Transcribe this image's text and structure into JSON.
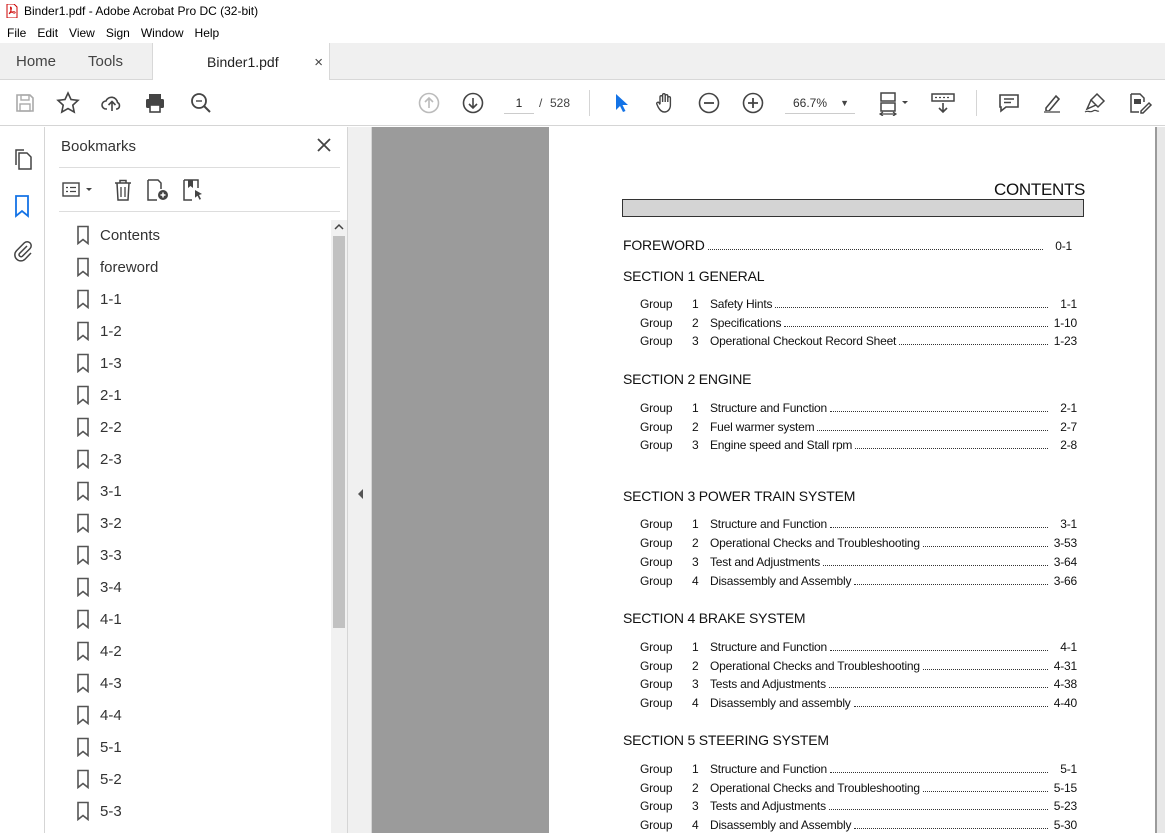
{
  "window": {
    "title": "Binder1.pdf - Adobe Acrobat Pro DC (32-bit)"
  },
  "menu": [
    "File",
    "Edit",
    "View",
    "Sign",
    "Window",
    "Help"
  ],
  "tabs": {
    "home": "Home",
    "tools": "Tools",
    "document": "Binder1.pdf",
    "close": "×"
  },
  "toolbar": {
    "page_current": "1",
    "page_sep": "/",
    "page_total": "528",
    "zoom": "66.7%"
  },
  "bookmarks": {
    "title": "Bookmarks",
    "items": [
      "Contents",
      "foreword",
      "1-1",
      "1-2",
      "1-3",
      "2-1",
      "2-2",
      "2-3",
      "3-1",
      "3-2",
      "3-3",
      "3-4",
      "4-1",
      "4-2",
      "4-3",
      "4-4",
      "5-1",
      "5-2",
      "5-3"
    ]
  },
  "document": {
    "heading": "CONTENTS",
    "foreword": {
      "label": "FOREWORD",
      "page": "0-1"
    },
    "sections": [
      {
        "title": "SECTION 1  GENERAL",
        "groups": [
          {
            "group": "Group",
            "num": "1",
            "title": "Safety Hints",
            "page": "1-1"
          },
          {
            "group": "Group",
            "num": "2",
            "title": "Specifications",
            "page": "1-10"
          },
          {
            "group": "Group",
            "num": "3",
            "title": "Operational Checkout Record Sheet",
            "page": "1-23"
          }
        ]
      },
      {
        "title": "SECTION 2  ENGINE",
        "groups": [
          {
            "group": "Group",
            "num": "1",
            "title": "Structure and Function",
            "page": "2-1"
          },
          {
            "group": "Group",
            "num": "2",
            "title": "Fuel warmer system",
            "page": "2-7"
          },
          {
            "group": "Group",
            "num": "3",
            "title": "Engine speed and Stall rpm",
            "page": "2-8"
          }
        ]
      },
      {
        "title": "SECTION 3  POWER TRAIN SYSTEM",
        "groups": [
          {
            "group": "Group",
            "num": "1",
            "title": "Structure and Function",
            "page": "3-1"
          },
          {
            "group": "Group",
            "num": "2",
            "title": "Operational Checks and Troubleshooting",
            "page": "3-53"
          },
          {
            "group": "Group",
            "num": "3",
            "title": "Test and Adjustments",
            "page": "3-64"
          },
          {
            "group": "Group",
            "num": "4",
            "title": "Disassembly and Assembly",
            "page": "3-66"
          }
        ]
      },
      {
        "title": "SECTION 4  BRAKE SYSTEM",
        "groups": [
          {
            "group": "Group",
            "num": "1",
            "title": "Structure and Function",
            "page": "4-1"
          },
          {
            "group": "Group",
            "num": "2",
            "title": "Operational Checks and Troubleshooting",
            "page": "4-31"
          },
          {
            "group": "Group",
            "num": "3",
            "title": "Tests and Adjustments",
            "page": "4-38"
          },
          {
            "group": "Group",
            "num": "4",
            "title": "Disassembly and assembly",
            "page": "4-40"
          }
        ]
      },
      {
        "title": "SECTION 5  STEERING SYSTEM",
        "groups": [
          {
            "group": "Group",
            "num": "1",
            "title": "Structure and Function",
            "page": "5-1"
          },
          {
            "group": "Group",
            "num": "2",
            "title": "Operational Checks and Troubleshooting",
            "page": "5-15"
          },
          {
            "group": "Group",
            "num": "3",
            "title": "Tests and Adjustments",
            "page": "5-23"
          },
          {
            "group": "Group",
            "num": "4",
            "title": "Disassembly and Assembly",
            "page": "5-30"
          }
        ]
      }
    ]
  }
}
